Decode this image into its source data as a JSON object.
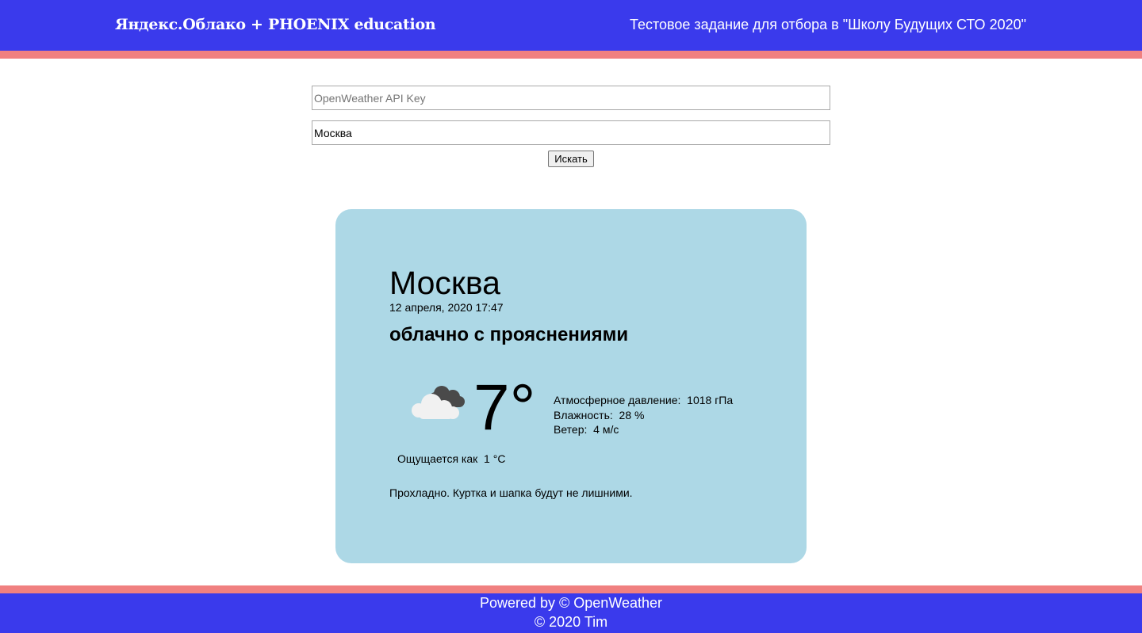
{
  "header": {
    "logo": "Яндекс.Облако + PHOENIX education",
    "subtitle": "Тестовое задание для отбора в \"Школу Будущих СТО 2020\"",
    "background_color": "#3a3aec",
    "accent_color": "#f08080"
  },
  "form": {
    "api_key_placeholder": "OpenWeather API Key",
    "api_key_value": "",
    "city_value": "Москва",
    "search_label": "Искать"
  },
  "weather": {
    "city": "Москва",
    "datetime": "12 апреля, 2020 17:47",
    "description": "облачно с прояснениями",
    "icon": "partly-cloudy-icon",
    "temperature": "7°",
    "pressure_row": "Атмосферное давление:  1018 гПа",
    "humidity_row": "Влажность:  28 %",
    "wind_row": "Ветер:  4 м/с",
    "feels_like_row": "Ощущается как  1 °C",
    "advice": "Прохладно. Куртка и шапка будут не лишними.",
    "card_color": "#add8e6"
  },
  "footer": {
    "powered_by": "Powered by © OpenWeather",
    "copyright": "© 2020 Tim"
  }
}
